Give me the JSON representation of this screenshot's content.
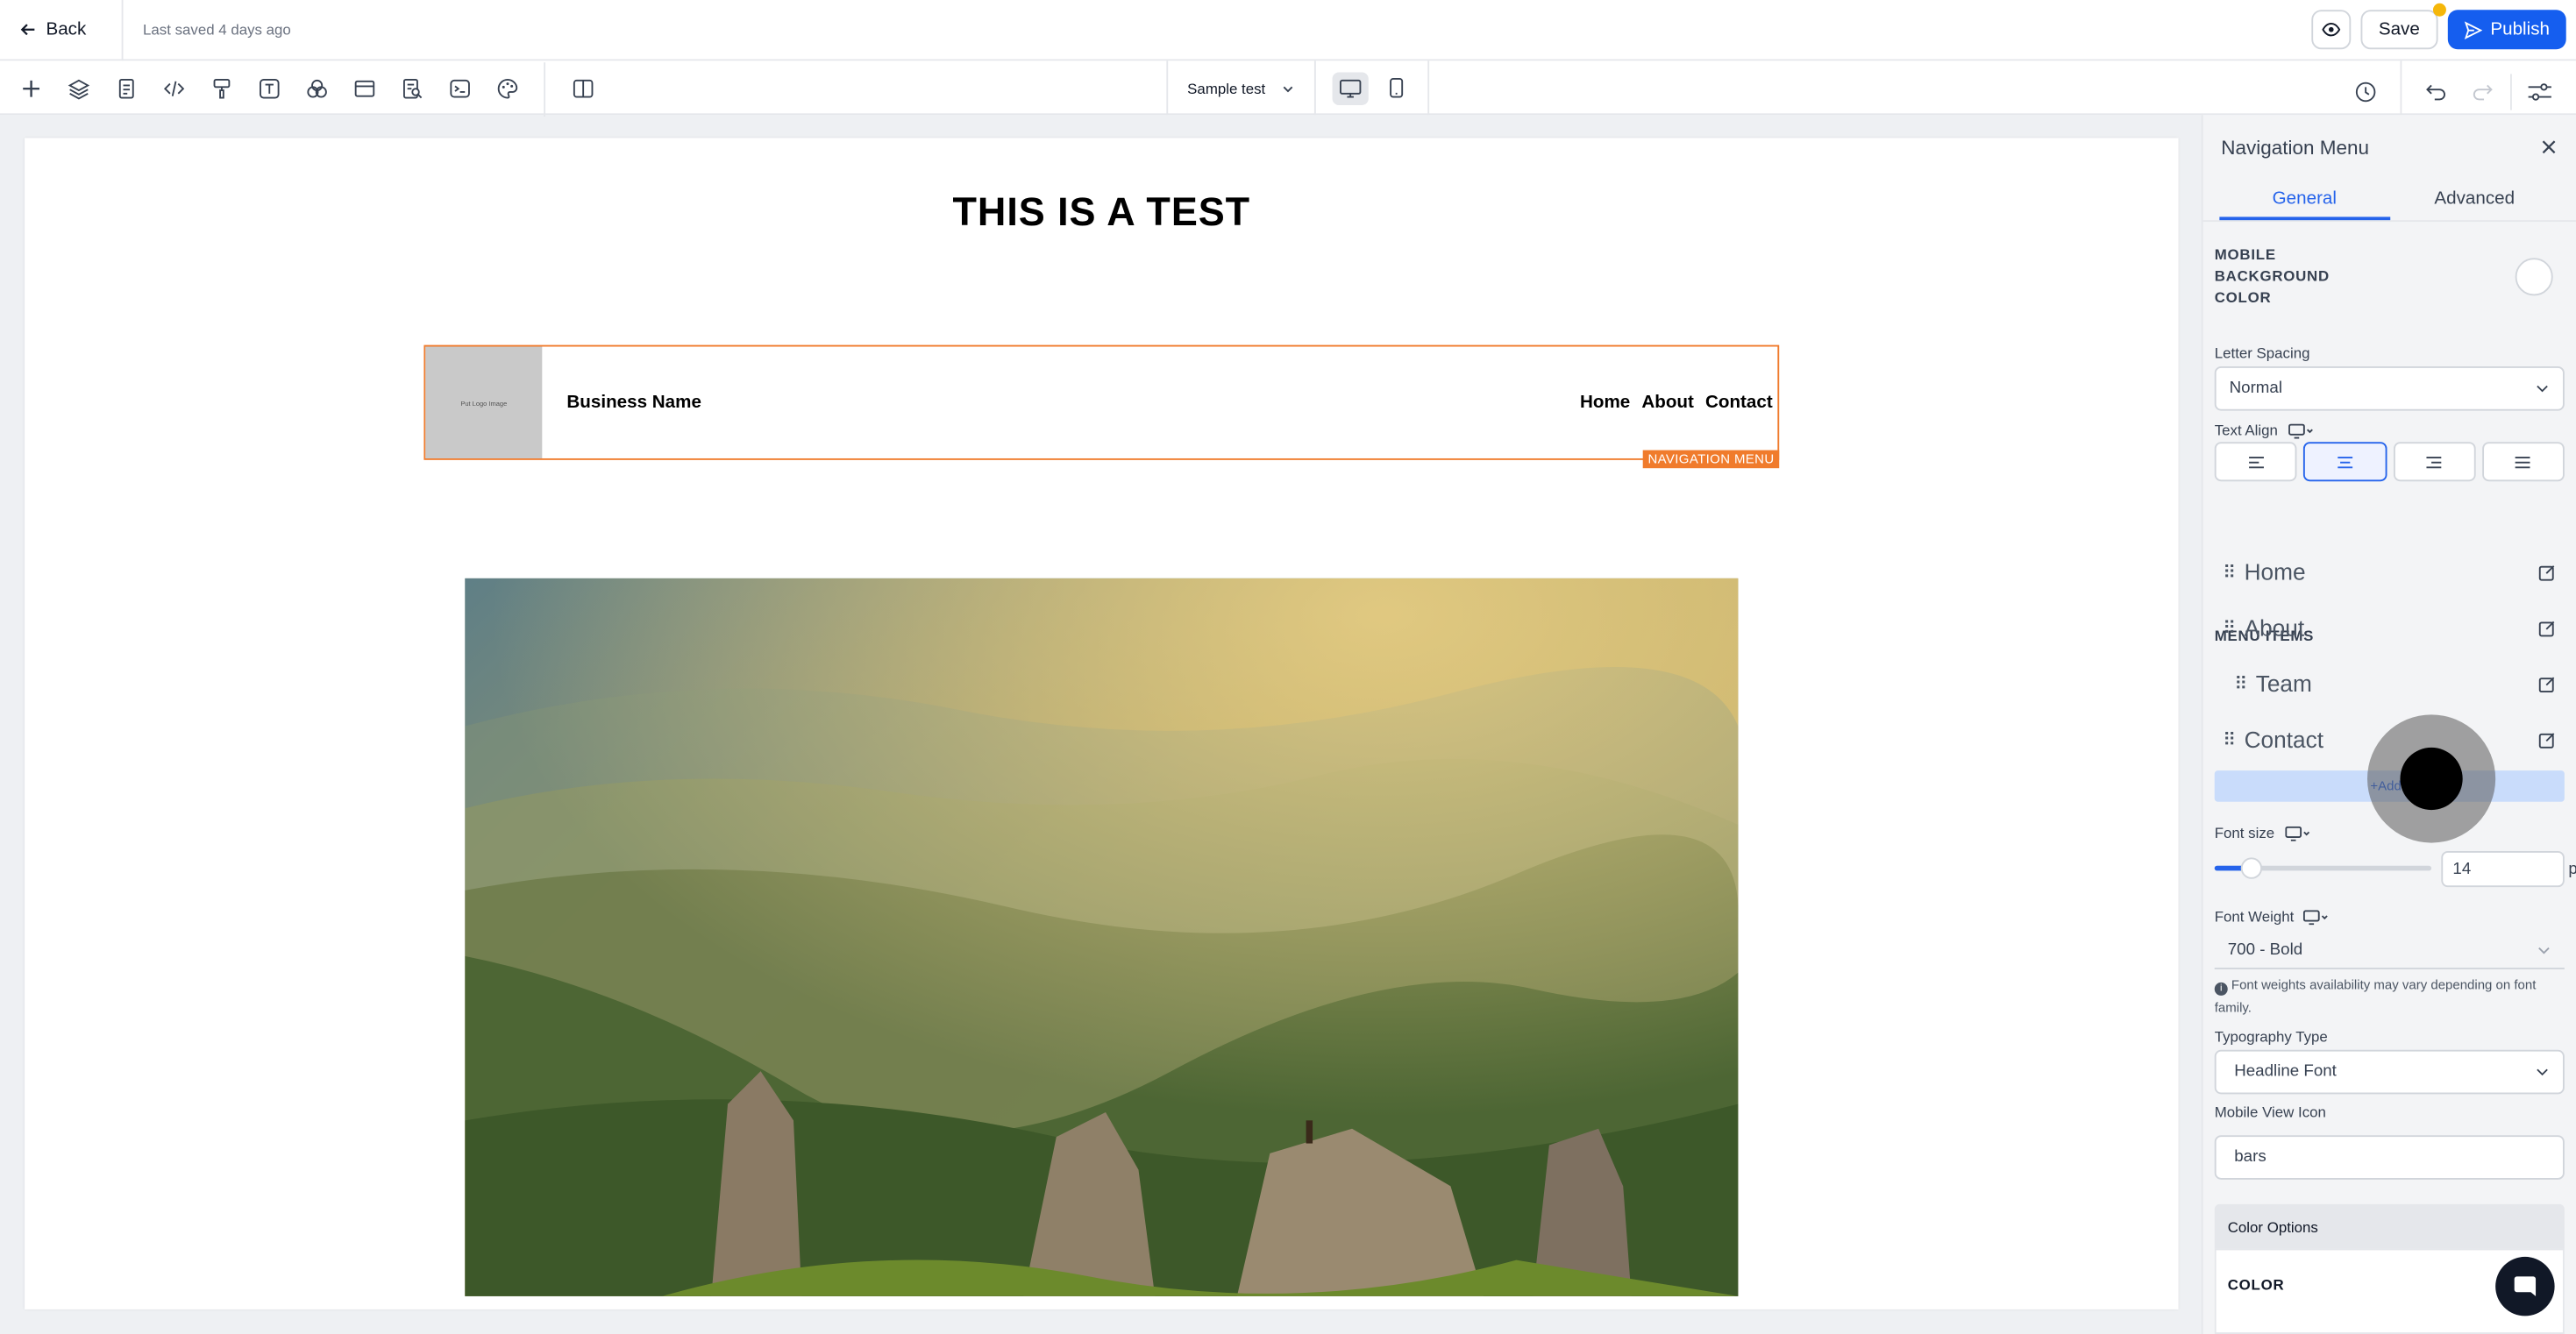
{
  "topbar": {
    "back_label": "Back",
    "saved_text": "Last saved 4 days ago",
    "save_label": "Save",
    "publish_label": "Publish"
  },
  "toolbar": {
    "tools": [
      "add-icon",
      "layers-icon",
      "pages-icon",
      "code-icon",
      "paint-icon",
      "text-icon",
      "shapes-icon",
      "layout-icon",
      "seo-icon",
      "terminal-icon",
      "palette-icon",
      "split-icon"
    ],
    "page_select": "Sample test"
  },
  "canvas": {
    "page_title": "THIS IS A TEST",
    "nav": {
      "logo_text": "Put Logo Image",
      "business_name": "Business Name",
      "links": [
        "Home",
        "About",
        "Contact"
      ],
      "tag": "NAVIGATION MENU"
    }
  },
  "panel": {
    "title": "Navigation Menu",
    "tabs": [
      "General",
      "Advanced"
    ],
    "mobile_bg_label": "MOBILE BACKGROUND COLOR",
    "letter_spacing_label": "Letter Spacing",
    "letter_spacing_value": "Normal",
    "text_align_label": "Text Align",
    "menu_items_label": "MENU ITEMS",
    "menu_items": [
      "Home",
      "About",
      "Team",
      "Contact"
    ],
    "add_label": "+Add I",
    "font_size_label": "Font size",
    "font_size_value": "14",
    "font_size_unit": "px",
    "font_size_fraction": 0.17,
    "font_weight_label": "Font Weight",
    "font_weight_value": "700 - Bold",
    "font_note": "Font weights availability may vary depending on font family.",
    "typography_label": "Typography Type",
    "typography_value": "Headline Font",
    "mobile_icon_label": "Mobile View Icon",
    "mobile_icon_value": "bars",
    "color_options_label": "Color Options",
    "color_label": "COLOR"
  },
  "colors": {
    "accent": "#155eef",
    "selection": "#f07b2c",
    "badge": "#f5b70a"
  }
}
